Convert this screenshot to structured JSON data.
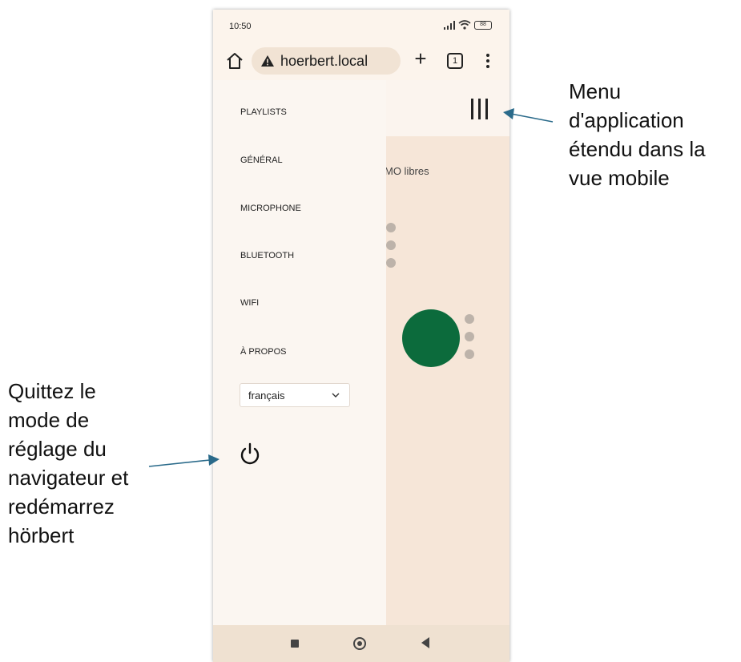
{
  "status_bar": {
    "time": "10:50",
    "battery": "88"
  },
  "browser": {
    "url": "hoerbert.local",
    "tab_count": "1"
  },
  "nav": {
    "items": [
      {
        "label": "PLAYLISTS"
      },
      {
        "label": "GÉNÉRAL"
      },
      {
        "label": "MICROPHONE"
      },
      {
        "label": "BLUETOOTH"
      },
      {
        "label": "WIFI"
      },
      {
        "label": "À PROPOS"
      }
    ],
    "language": "français"
  },
  "background_content": {
    "partial_text": "MO libres"
  },
  "colors": {
    "accent_green": "#0c6b3c",
    "arrow": "#2a6a8a"
  },
  "annotations": {
    "menu": "Menu d'application étendu dans la vue mobile",
    "power": "Quittez le mode de réglage du navigateur et redémarrez hörbert"
  }
}
